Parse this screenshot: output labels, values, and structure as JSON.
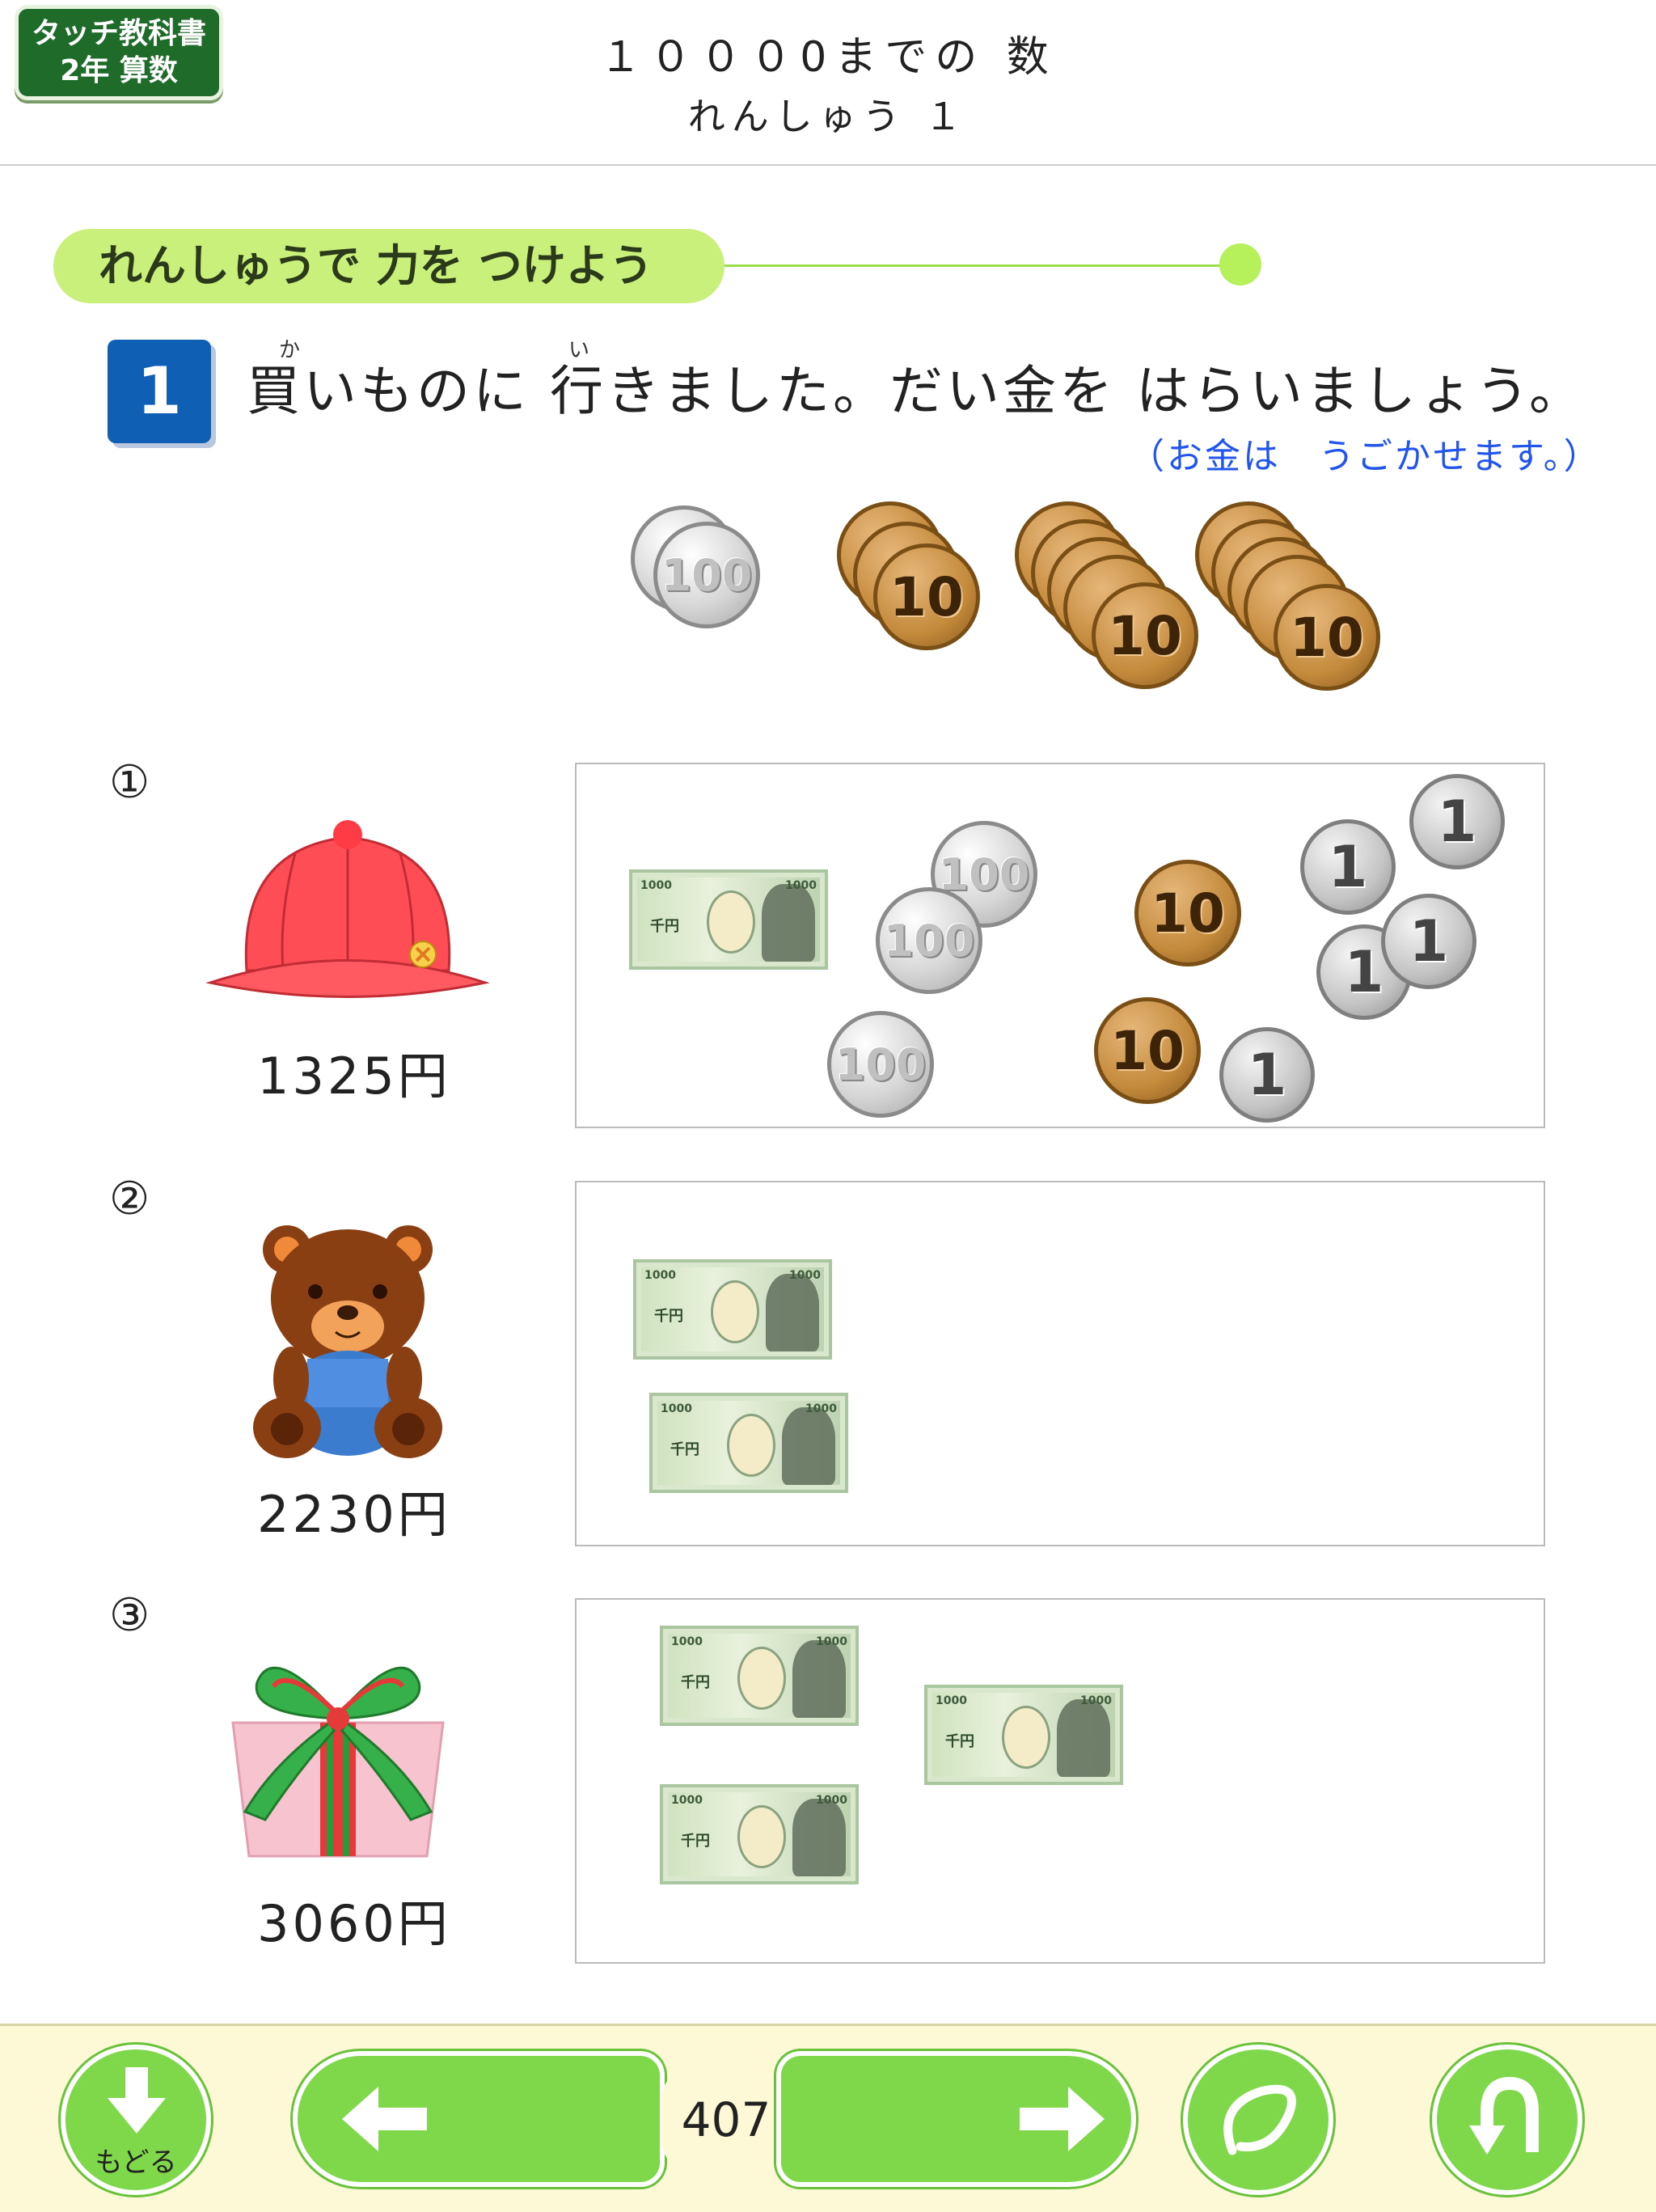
{
  "header": {
    "badge_line1": "タッチ教科書",
    "badge_line2": "2年 算数",
    "title": "１０００0までの 数",
    "subtitle": "れんしゅう １"
  },
  "section": {
    "label": "れんしゅうで 力を つけよう"
  },
  "question": {
    "number": "1",
    "text": "買いものに 行きました。だい金を はらいましょう。",
    "ruby_ka": "か",
    "ruby_i": "い",
    "hint": "（お金は　うごかせます。）"
  },
  "palette": {
    "coin_100": "100",
    "coin_10": "10"
  },
  "items": [
    {
      "marker": "①",
      "name": "hat",
      "price": "1325円"
    },
    {
      "marker": "②",
      "name": "bear",
      "price": "2230円"
    },
    {
      "marker": "③",
      "name": "gift",
      "price": "3060円"
    }
  ],
  "money_labels": {
    "bill": "1000",
    "bill_kanji": "千円",
    "coin_100": "100",
    "coin_10": "10",
    "coin_1": "1"
  },
  "footer": {
    "back_label": "もどる",
    "page_number": "407"
  },
  "colors": {
    "accent_green": "#7fd84a",
    "badge_green": "#1f6b2a",
    "question_blue": "#0f5fb5",
    "hint_blue": "#2255ee"
  }
}
